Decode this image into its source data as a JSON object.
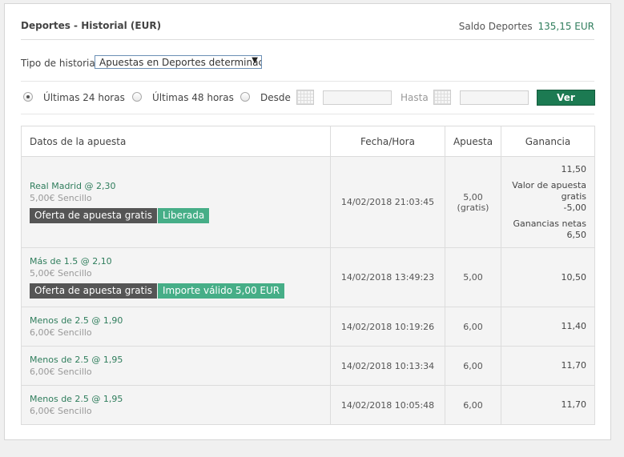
{
  "header": {
    "title": "Deportes - Historial (EUR)",
    "balance_label": "Saldo Deportes",
    "balance_amount": "135,15 EUR"
  },
  "history_type": {
    "label": "Tipo de historial",
    "selected": "Apuestas en Deportes determinac"
  },
  "filters": {
    "last24": "Últimas 24 horas",
    "last48": "Últimas 48 horas",
    "from": "Desde",
    "to": "Hasta",
    "view_button": "Ver",
    "from_value": "",
    "to_value": ""
  },
  "table": {
    "columns": [
      "Datos de la apuesta",
      "Fecha/Hora",
      "Apuesta",
      "Ganancia"
    ],
    "rows": [
      {
        "selection": "Real Madrid @ 2,30",
        "detail": "5,00€ Sencillo",
        "tag1": "Oferta de apuesta gratis",
        "tag2": "Liberada",
        "datetime": "14/02/2018 21:03:45",
        "stake": "5,00",
        "stake_note": "(gratis)",
        "win_gross": "11,50",
        "win_free_label": "Valor de apuesta gratis",
        "win_free_value": "-5,00",
        "win_net_label": "Ganancias netas",
        "win_net_value": "6,50"
      },
      {
        "selection": "Más de 1.5 @ 2,10",
        "detail": "5,00€ Sencillo",
        "tag1": "Oferta de apuesta gratis",
        "tag2": "Importe válido 5,00 EUR",
        "datetime": "14/02/2018 13:49:23",
        "stake": "5,00",
        "win": "10,50"
      },
      {
        "selection": "Menos de 2.5 @ 1,90",
        "detail": "6,00€ Sencillo",
        "datetime": "14/02/2018 10:19:26",
        "stake": "6,00",
        "win": "11,40"
      },
      {
        "selection": "Menos de 2.5 @ 1,95",
        "detail": "6,00€ Sencillo",
        "datetime": "14/02/2018 10:13:34",
        "stake": "6,00",
        "win": "11,70"
      },
      {
        "selection": "Menos de 2.5 @ 1,95",
        "detail": "6,00€ Sencillo",
        "datetime": "14/02/2018 10:05:48",
        "stake": "6,00",
        "win": "11,70"
      }
    ]
  },
  "colors": {
    "accent_green": "#2f7d5c",
    "button_green": "#1c7a52",
    "tag_dark": "#555555",
    "tag_green": "#46ae87"
  }
}
